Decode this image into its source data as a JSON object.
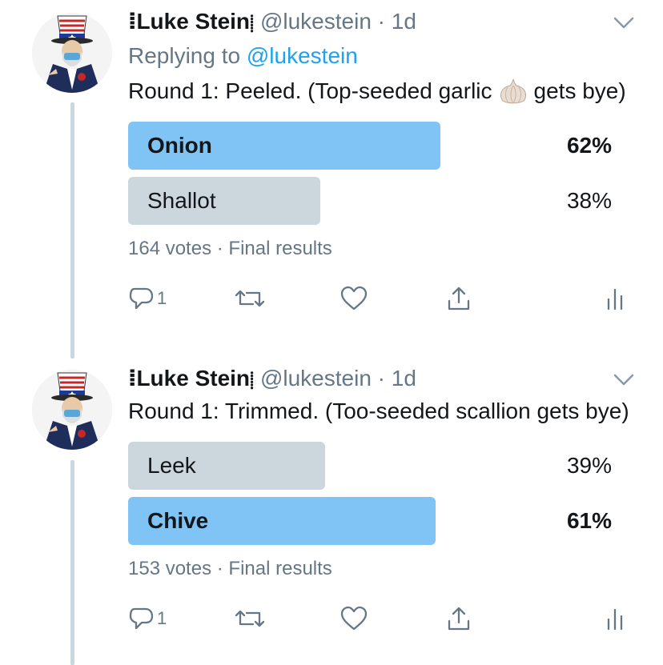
{
  "tweets": [
    {
      "author": {
        "display_name": "⸽Luke Stein⸽",
        "name_prefix": "ⵂ",
        "name_core": "Luke Stein",
        "name_suffix": "⸽",
        "handle": "@lukestein",
        "time": "1d"
      },
      "reply_prefix": "Replying to",
      "reply_handle": "@lukestein",
      "text_before": "Round 1: Peeled. (Top-seeded garlic",
      "text_after": "gets bye)",
      "emoji_icon": "garlic-emoji",
      "poll": {
        "options": [
          {
            "label": "Onion",
            "percent_text": "62%",
            "fraction": 0.62,
            "winner": true
          },
          {
            "label": "Shallot",
            "percent_text": "38%",
            "fraction": 0.38,
            "winner": false
          }
        ],
        "votes": "164 votes",
        "status": "Final results"
      },
      "actions": {
        "reply_count": "1"
      }
    },
    {
      "author": {
        "name_prefix": "ⵂ",
        "name_core": "Luke Stein",
        "name_suffix": "⸽",
        "handle": "@lukestein",
        "time": "1d"
      },
      "text_before": "Round 1: Trimmed. (Too-seeded scallion gets bye)",
      "poll": {
        "options": [
          {
            "label": "Leek",
            "percent_text": "39%",
            "fraction": 0.39,
            "winner": false
          },
          {
            "label": "Chive",
            "percent_text": "61%",
            "fraction": 0.61,
            "winner": true
          }
        ],
        "votes": "153 votes",
        "status": "Final results"
      },
      "actions": {
        "reply_count": "1"
      }
    }
  ],
  "separator": "·",
  "colors": {
    "accent": "#1da1f2",
    "winner_bar": "#7fc4f5",
    "loser_bar": "#ccd6dd",
    "muted": "#657786",
    "thread_line": "#ccd6dd"
  }
}
